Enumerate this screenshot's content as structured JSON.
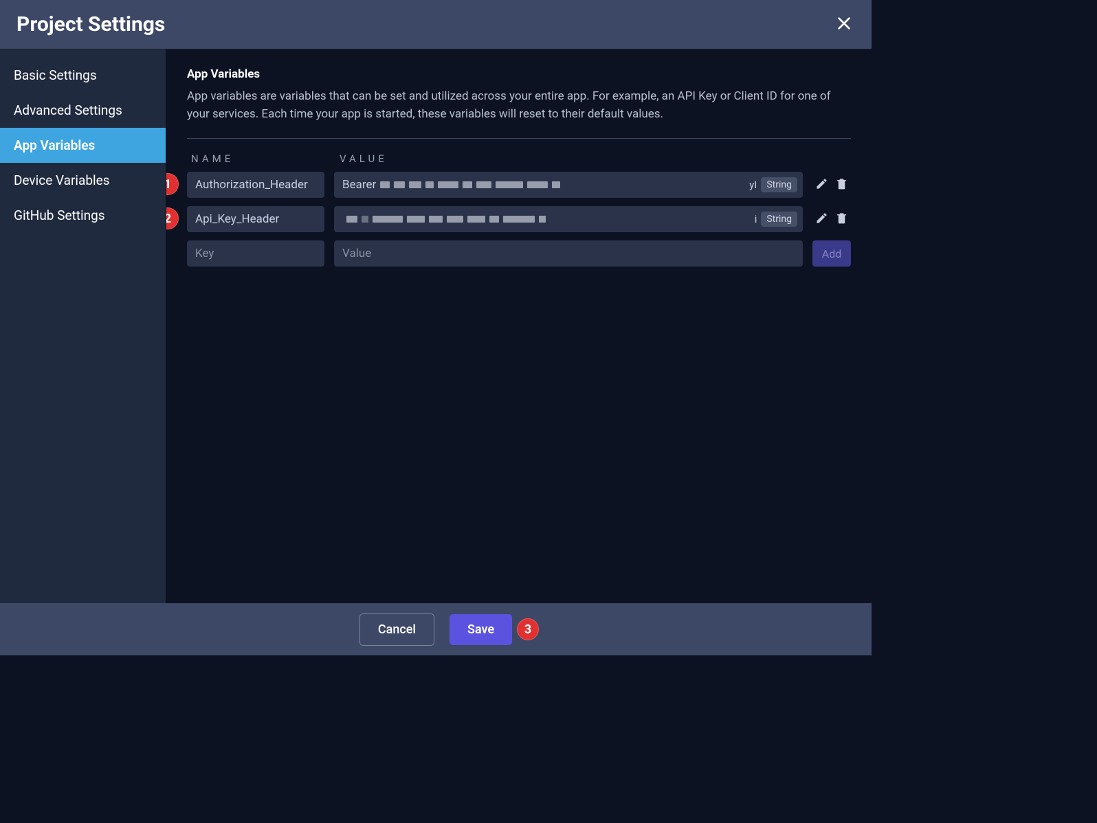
{
  "header": {
    "title": "Project Settings"
  },
  "sidebar": {
    "items": [
      {
        "label": "Basic Settings",
        "active": false
      },
      {
        "label": "Advanced Settings",
        "active": false
      },
      {
        "label": "App Variables",
        "active": true
      },
      {
        "label": "Device Variables",
        "active": false
      },
      {
        "label": "GitHub Settings",
        "active": false
      }
    ]
  },
  "main": {
    "section_title": "App Variables",
    "section_desc": "App variables are variables that can be set and utilized across your entire app. For example, an API Key or Client ID for one of your services. Each time your app is started, these variables will reset to their default values.",
    "col_name": "NAME",
    "col_value": "VALUE",
    "rows": [
      {
        "name": "Authorization_Header",
        "value_prefix": "Bearer ",
        "value_tail": "yI",
        "type": "String"
      },
      {
        "name": "Api_Key_Header",
        "value_prefix": "",
        "value_tail": "i",
        "type": "String"
      }
    ],
    "new_row": {
      "key_placeholder": "Key",
      "value_placeholder": "Value",
      "add_label": "Add"
    }
  },
  "footer": {
    "cancel": "Cancel",
    "save": "Save"
  },
  "annotations": {
    "one": "1",
    "two": "2",
    "three": "3"
  }
}
